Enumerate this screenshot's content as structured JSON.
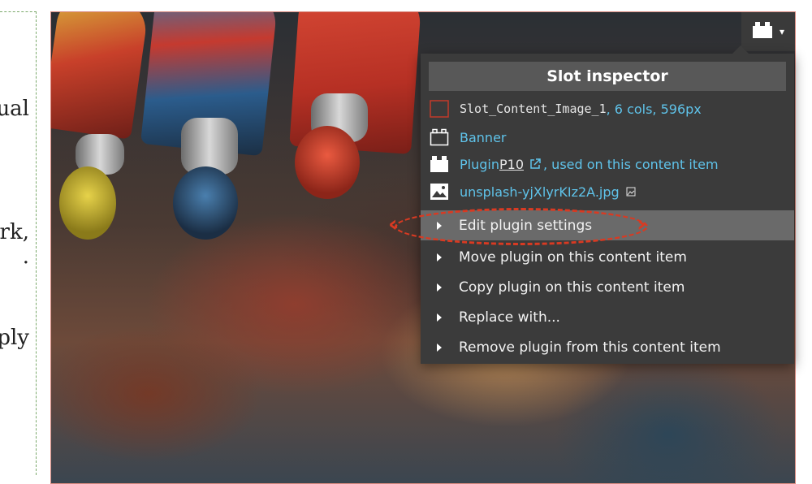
{
  "left_text_fragments": [
    "ual",
    "rk,",
    "·",
    "ply"
  ],
  "plugin_toggle": {
    "icon": "plugin-icon",
    "caret": "▾"
  },
  "inspector": {
    "title": "Slot inspector",
    "slot": {
      "name": "Slot_Content_Image_1",
      "detail": ", 6 cols, 596px"
    },
    "template": {
      "label": "Banner"
    },
    "plugin": {
      "prefix": "Plugin ",
      "code": "P10",
      "suffix": ", used on this content item"
    },
    "file": {
      "name": "unsplash-yjXlyrKIz2A.jpg"
    },
    "actions": [
      "Edit plugin settings",
      "Move plugin on this content item",
      "Copy plugin on this content item",
      "Replace with...",
      "Remove plugin from this content item"
    ]
  },
  "colors": {
    "accent_link": "#5fc3ea",
    "highlight": "#d93a22",
    "panel_bg": "#3b3b3b"
  }
}
